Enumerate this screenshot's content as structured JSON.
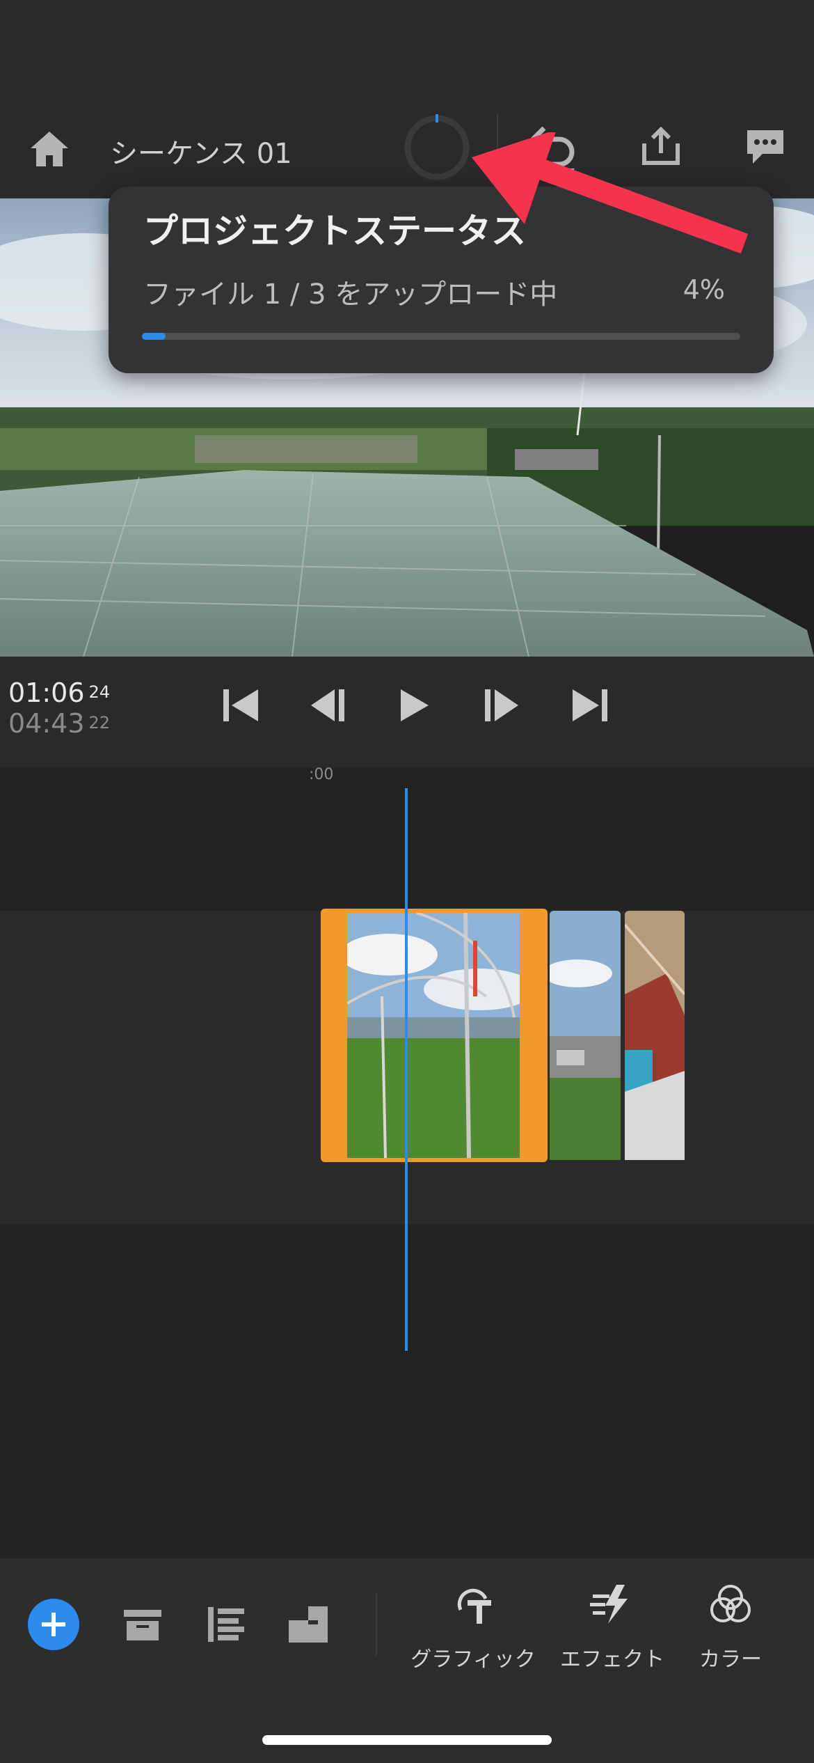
{
  "header": {
    "sequence_title": "シーケンス 01"
  },
  "icons": {
    "home": "home-icon",
    "sync": "sync-status-ring-icon",
    "undo": "undo-icon",
    "share": "share-icon",
    "comments": "comment-icon"
  },
  "status_popover": {
    "title": "プロジェクトステータス",
    "message": "ファイル 1 / 3 をアップロード中",
    "percent_label": "4%",
    "progress": 0.04
  },
  "transport": {
    "current_time": "01:06",
    "current_frames": "24",
    "duration_time": "04:43",
    "duration_frames": "22"
  },
  "timeline": {
    "ruler_label": ":00"
  },
  "bottom_tools": {
    "graphics_label": "グラフィック",
    "effects_label": "エフェクト",
    "color_label": "カラー"
  },
  "colors": {
    "accent_blue": "#2d8ceb",
    "selection_orange": "#f1992a",
    "annotation_red": "#f4344e"
  }
}
